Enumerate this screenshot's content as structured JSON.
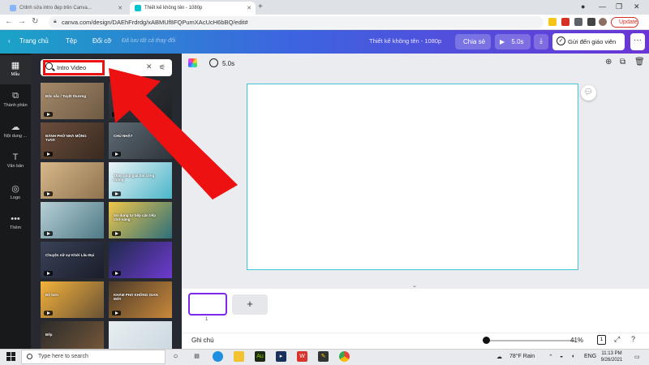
{
  "browser": {
    "tabs": [
      {
        "label": "Chỉnh sửa intro đẹp trên Canva..."
      },
      {
        "label": "Thiết kế không tên - 1080p"
      }
    ],
    "url": "canva.com/design/DAEhFrdrdg/xABMUf8FQPumXAcUcH6bBQ/edit#",
    "update_label": "Update"
  },
  "topbar": {
    "home": "Trang chủ",
    "file": "Tệp",
    "resize": "Đổi cỡ",
    "saved": "Đã lưu tất cả thay đổi",
    "title": "Thiết kế không tên - 1080p",
    "share": "Chia sẻ",
    "play_duration": "5.0s",
    "send_teacher": "Gửi đến giáo viên",
    "more": "···"
  },
  "rail": [
    {
      "label": "Mẫu",
      "icon": "template-icon"
    },
    {
      "label": "Thành phần",
      "icon": "elements-icon"
    },
    {
      "label": "Nội dung ...",
      "icon": "upload-icon"
    },
    {
      "label": "Văn bản",
      "icon": "text-icon"
    },
    {
      "label": "Logo",
      "icon": "logo-icon"
    },
    {
      "label": "Thêm",
      "icon": "more-icon"
    }
  ],
  "search": {
    "value": "Intro Video"
  },
  "thumbs": [
    {
      "caption": "Độc sắc / Tuyệt thương",
      "colors": [
        "#a48a6a",
        "#6f5a44"
      ]
    },
    {
      "caption": "",
      "colors": [
        "#35383d",
        "#1f2125"
      ]
    },
    {
      "caption": "BÁNH PHỞ NHÀ MỘNG TƯƠI",
      "colors": [
        "#6b4e3c",
        "#3a2a20"
      ]
    },
    {
      "caption": "CHỦ NHẬT",
      "colors": [
        "#5f6a73",
        "#2f363c"
      ]
    },
    {
      "caption": "",
      "colors": [
        "#d8b88a",
        "#8f7350"
      ]
    },
    {
      "caption": "Thảo giúp giải bài công thông",
      "colors": [
        "#eef4f6",
        "#4ab5c9"
      ]
    },
    {
      "caption": "",
      "colors": [
        "#b8cfd6",
        "#4d7a86"
      ]
    },
    {
      "caption": "Sử dụng tự tiếp cận tiếp chữ năng",
      "colors": [
        "#f0c64a",
        "#2d6f7a"
      ]
    },
    {
      "caption": "Chuyện nữ sự Khởi Lâu Đại",
      "colors": [
        "#3a4258",
        "#1a1e2a"
      ]
    },
    {
      "caption": "",
      "colors": [
        "#1f2a4a",
        "#6d3ad0"
      ]
    },
    {
      "caption": "Đồ bơn",
      "colors": [
        "#f3b23a",
        "#6a5236"
      ]
    },
    {
      "caption": "KHÁM PHÁ KHÔNG GIAN MỚI",
      "colors": [
        "#4a3a2a",
        "#c9883a"
      ]
    },
    {
      "caption": "Bếp",
      "colors": [
        "#2b2b2b",
        "#7a5a3a"
      ]
    },
    {
      "caption": "",
      "colors": [
        "#e8eef2",
        "#c9d6de"
      ]
    }
  ],
  "editor": {
    "duration": "5.0s",
    "page_number": "1",
    "notes": "Ghi chú",
    "zoom": "41%",
    "page_count": "1",
    "zoom_level": 0.03
  },
  "taskbar": {
    "search_placeholder": "Type here to search",
    "weather": "78°F  Rain",
    "lang": "ENG",
    "time": "11:13 PM",
    "date": "9/26/2021"
  },
  "colors": {
    "accent_purple": "#7d2ae8",
    "canvas_border": "#3fc6d4",
    "highlight_red": "#ee1111"
  }
}
